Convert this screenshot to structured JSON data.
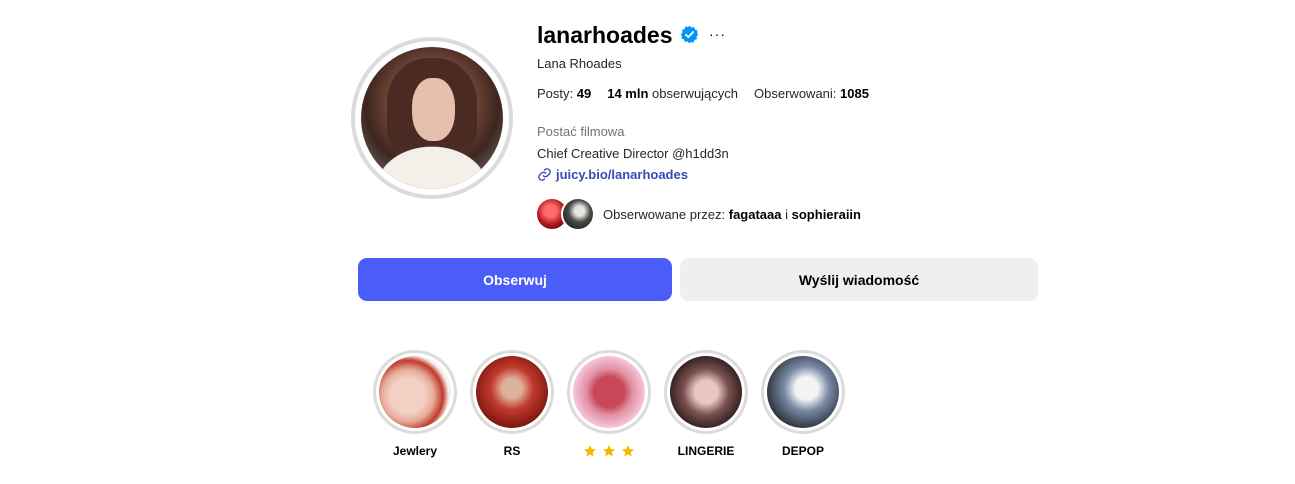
{
  "profile": {
    "username": "lanarhoades",
    "full_name": "Lana Rhoades",
    "verified_icon": "verified-badge-icon",
    "more_icon": "···",
    "stats": {
      "posts_label": "Posty:",
      "posts_value": "49",
      "followers_value": "14 mln",
      "followers_label": "obserwujących",
      "following_label": "Obserwowani:",
      "following_value": "1085"
    },
    "category": "Postać filmowa",
    "bio": "Chief Creative Director @h1dd3n",
    "link": "juicy.bio/lanarhoades",
    "mutuals": {
      "prefix": "Obserwowane przez:",
      "user1": "fagataaa",
      "conjunction": "i",
      "user2": "sophieraiin"
    }
  },
  "actions": {
    "follow_label": "Obserwuj",
    "message_label": "Wyślij wiadomość"
  },
  "highlights": [
    {
      "label": "Jewlery"
    },
    {
      "label": "RS"
    },
    {
      "label": "",
      "icon": "star-icon",
      "count": 3
    },
    {
      "label": "LINGERIE"
    },
    {
      "label": "DEPOP"
    }
  ],
  "colors": {
    "accent": "#4a5df9",
    "link": "#3a4ab4",
    "verified": "#0095f6",
    "star": "#f5b800"
  }
}
